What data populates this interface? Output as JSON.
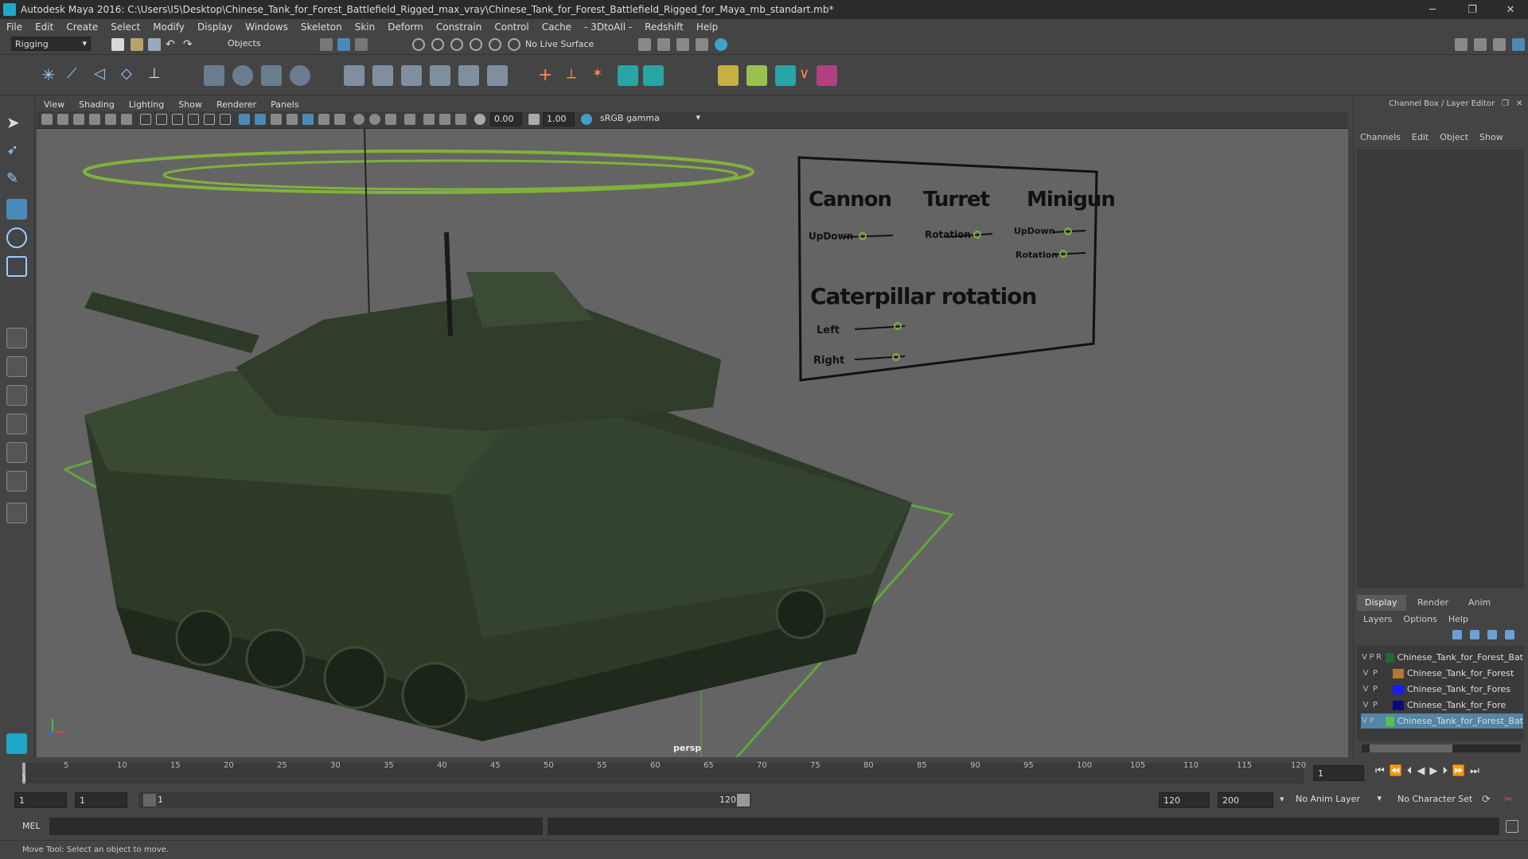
{
  "window": {
    "title": "Autodesk Maya 2016: C:\\Users\\I5\\Desktop\\Chinese_Tank_for_Forest_Battlefield_Rigged_max_vray\\Chinese_Tank_for_Forest_Battlefield_Rigged_for_Maya_mb_standart.mb*",
    "minimize": "─",
    "maximize": "❐",
    "close": "✕"
  },
  "menubar": [
    "File",
    "Edit",
    "Create",
    "Select",
    "Modify",
    "Display",
    "Windows",
    "Skeleton",
    "Skin",
    "Deform",
    "Constrain",
    "Control",
    "Cache",
    "- 3DtoAll -",
    "Redshift",
    "Help"
  ],
  "statusline": {
    "menuset": "Rigging",
    "selection_mode": "Objects",
    "live_surface": "No Live Surface"
  },
  "panel_menu": [
    "View",
    "Shading",
    "Lighting",
    "Show",
    "Renderer",
    "Panels"
  ],
  "panel_toolbar": {
    "exposure": "0.00",
    "gamma": "1.00",
    "color_space": "sRGB gamma"
  },
  "viewport": {
    "camera_label": "persp",
    "background": "#646464"
  },
  "control_board": {
    "cannon": "Cannon",
    "turret": "Turret",
    "minigun": "Minigun",
    "updown": "UpDown",
    "rotation": "Rotation",
    "updown2": "UpDown",
    "rotation2": "Rotation",
    "caterpillar": "Caterpillar rotation",
    "left": "Left",
    "right": "Right"
  },
  "channel_box": {
    "header": "Channel Box / Layer Editor",
    "menus": [
      "Channels",
      "Edit",
      "Object",
      "Show"
    ]
  },
  "layer_editor": {
    "tabs": [
      "Display",
      "Render",
      "Anim"
    ],
    "menus": [
      "Layers",
      "Options",
      "Help"
    ],
    "layers": [
      {
        "v": "V",
        "p": "P",
        "r": "R",
        "color": "#1f6b2a",
        "name": "Chinese_Tank_for_Forest_Bat"
      },
      {
        "v": "V",
        "p": "P",
        "r": "",
        "color": "#b0783a",
        "name": "Chinese_Tank_for_Forest"
      },
      {
        "v": "V",
        "p": "P",
        "r": "",
        "color": "#1b1bff",
        "name": "Chinese_Tank_for_Fores"
      },
      {
        "v": "V",
        "p": "P",
        "r": "",
        "color": "#0a0a7a",
        "name": "Chinese_Tank_for_Fore"
      },
      {
        "v": "V",
        "p": "P",
        "r": "",
        "color": "#59c04a",
        "name": "Chinese_Tank_for_Forest_Bat"
      }
    ]
  },
  "timeline": {
    "ticks": [
      "1",
      "5",
      "10",
      "15",
      "20",
      "25",
      "30",
      "35",
      "40",
      "45",
      "50",
      "55",
      "60",
      "65",
      "70",
      "75",
      "80",
      "85",
      "90",
      "95",
      "100",
      "105",
      "110",
      "115",
      "120"
    ],
    "current_frame": "1"
  },
  "range": {
    "start": "1",
    "playback_start": "1",
    "slider_start": "1",
    "slider_end": "120",
    "playback_end": "120",
    "end": "200",
    "anim_layer": "No Anim Layer",
    "char_set": "No Character Set"
  },
  "cmdline": {
    "label": "MEL"
  },
  "help": {
    "text": "Move Tool: Select an object to move."
  }
}
